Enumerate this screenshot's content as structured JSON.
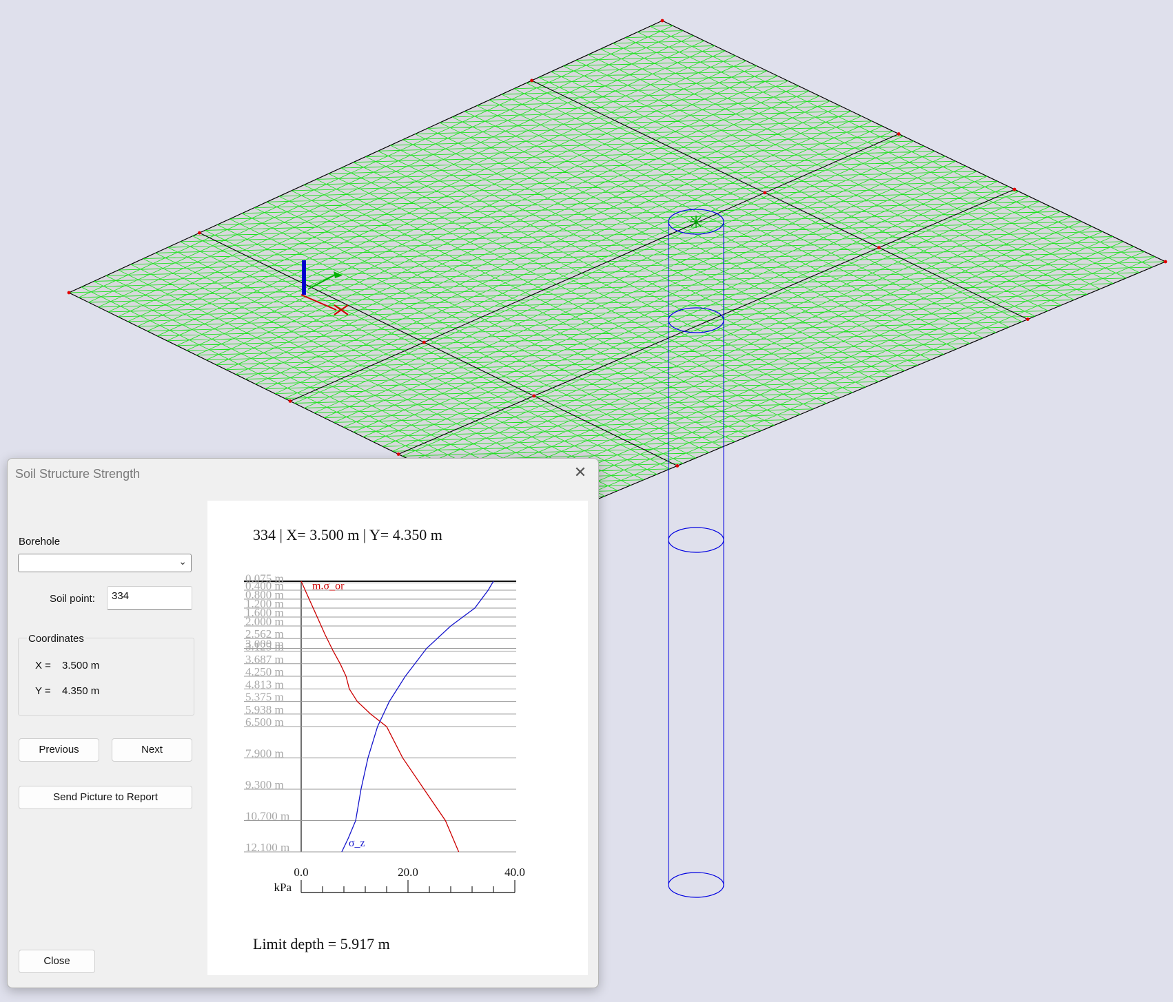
{
  "dialog": {
    "title": "Soil Structure Strength",
    "borehole_label": "Borehole",
    "borehole_value": "",
    "soil_point_label": "Soil point:",
    "soil_point_value": "334",
    "coordinates": {
      "group_label": "Coordinates",
      "x_label": "X =",
      "x_value": "3.500 m",
      "y_label": "Y =",
      "y_value": "4.350 m"
    },
    "buttons": {
      "previous": "Previous",
      "next": "Next",
      "send_report": "Send Picture to Report",
      "close": "Close"
    }
  },
  "chart_title": "334 | X= 3.500 m | Y= 4.350 m",
  "limit_depth": "Limit depth = 5.917 m",
  "chart_data": {
    "type": "line",
    "title": "334 | X= 3.500 m | Y= 4.350 m",
    "xlabel": "kPa",
    "ylabel": "",
    "xlim": [
      0,
      40
    ],
    "ylim": [
      0,
      12.1
    ],
    "x_ticks": [
      "0.0",
      "20.0",
      "40.0"
    ],
    "depth_labels": [
      "0.075 m",
      "0.400 m",
      "0.800 m",
      "1.200 m",
      "1.600 m",
      "2.000 m",
      "2.562 m",
      "3.000 m",
      "3.125 m",
      "3.687 m",
      "4.250 m",
      "4.813 m",
      "5.375 m",
      "5.938 m",
      "6.500 m",
      "7.900 m",
      "9.300 m",
      "10.700 m",
      "12.100 m"
    ],
    "depths": [
      0.075,
      0.4,
      0.8,
      1.2,
      1.6,
      2.0,
      2.562,
      3.0,
      3.125,
      3.687,
      4.25,
      4.813,
      5.375,
      5.938,
      6.5,
      7.9,
      9.3,
      10.7,
      12.1
    ],
    "series": [
      {
        "name": "m.σ_or",
        "color": "#cc0000",
        "x": [
          0.0,
          1.5,
          3.0,
          4.5,
          6.0,
          7.3,
          8.4,
          9.0,
          10.5,
          13.0,
          16.0,
          19.0,
          23.0,
          27.0,
          29.5
        ],
        "y": [
          0.0,
          0.8,
          1.6,
          2.4,
          3.125,
          3.687,
          4.25,
          4.813,
          5.375,
          5.938,
          6.5,
          7.9,
          9.3,
          10.7,
          12.1
        ]
      },
      {
        "name": "σ_z",
        "color": "#1515cc",
        "x": [
          36.0,
          35.0,
          32.5,
          28.0,
          23.5,
          19.5,
          16.5,
          14.3,
          12.5,
          11.2,
          10.2,
          8.8,
          7.6
        ],
        "y": [
          0.0,
          0.4,
          1.2,
          2.0,
          3.0,
          4.25,
          5.375,
          6.5,
          7.9,
          9.3,
          10.7,
          11.5,
          12.1
        ]
      }
    ]
  },
  "viewport": {
    "mesh_color": "#00e400",
    "slab_color": "#d8d8dd",
    "pile_color": "#0000e0"
  }
}
